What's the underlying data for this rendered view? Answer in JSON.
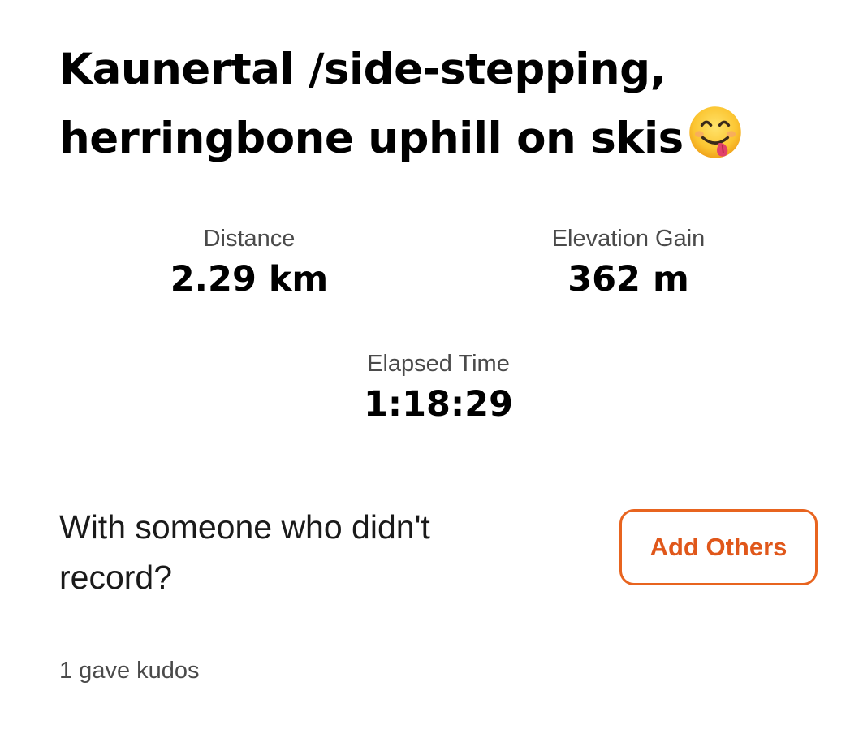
{
  "activity": {
    "title": "Kaunertal /side-stepping, herringbone uphill on skis",
    "title_emoji": "face-savoring-food-icon"
  },
  "stats": {
    "distance": {
      "label": "Distance",
      "value": "2.29 km"
    },
    "elevation_gain": {
      "label": "Elevation Gain",
      "value": "362 m"
    },
    "elapsed_time": {
      "label": "Elapsed Time",
      "value": "1:18:29"
    }
  },
  "with_others": {
    "prompt": "With someone who didn't record?",
    "button_label": "Add Others"
  },
  "kudos": {
    "text": "1 gave kudos"
  },
  "colors": {
    "accent": "#e8641f",
    "label_gray": "#4a4a4a",
    "text": "#000000",
    "background": "#ffffff"
  }
}
